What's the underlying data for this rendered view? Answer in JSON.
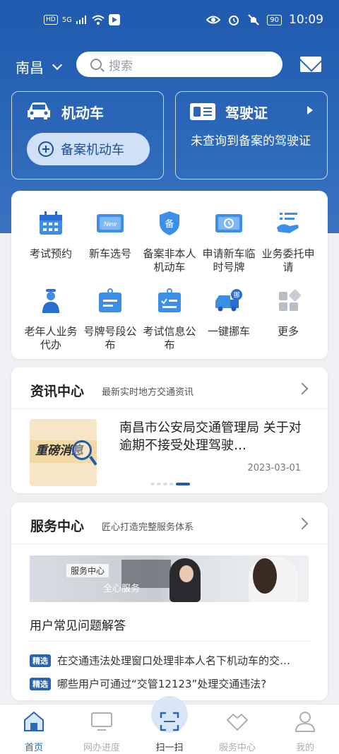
{
  "status_bar": {
    "hd": "HD",
    "signal": "5G",
    "battery": "90",
    "time": "10:09"
  },
  "header": {
    "city": "南昌",
    "search_placeholder": "搜索"
  },
  "cards": {
    "vehicle": {
      "title": "机动车",
      "button": "备案机动车"
    },
    "license": {
      "title": "驾驶证",
      "text": "未查询到备案的驾驶证"
    }
  },
  "services_grid": [
    {
      "label": "考试预约",
      "icon": "calendar-icon"
    },
    {
      "label": "新车选号",
      "icon": "new-plate-icon"
    },
    {
      "label": "备案非本人机动车",
      "icon": "record-shield-icon"
    },
    {
      "label": "申请新车临时号牌",
      "icon": "temp-plate-icon"
    },
    {
      "label": "业务委托申请",
      "icon": "delegate-icon"
    },
    {
      "label": "老年人业务代办",
      "icon": "elder-icon"
    },
    {
      "label": "号牌号段公布",
      "icon": "plate-segment-icon"
    },
    {
      "label": "考试信息公布",
      "icon": "exam-info-icon"
    },
    {
      "label": "一键挪车",
      "icon": "move-car-icon"
    },
    {
      "label": "更多",
      "icon": "more-icon"
    }
  ],
  "news": {
    "title": "资讯中心",
    "subtitle": "最新实时地方交通资讯",
    "thumb_text": "重磅消息",
    "item_title": "南昌市公安局交通管理局 关于对逾期不接受处理驾驶…",
    "item_date": "2023-03-01"
  },
  "service": {
    "title": "服务中心",
    "subtitle": "匠心打造完整服务体系",
    "banner_tag": "服务中心",
    "banner_text": "全心服务",
    "faq_title": "用户常见问题解答",
    "faq_badge": "精选",
    "faqs": [
      "在交通违法处理窗口处理非本人名下机动车的交…",
      "哪些用户可通过“交管12123”处理交通违法?"
    ]
  },
  "nav": [
    {
      "label": "首页",
      "active": true
    },
    {
      "label": "网办进度"
    },
    {
      "label": "扫一扫"
    },
    {
      "label": "服务中心"
    },
    {
      "label": "我的"
    }
  ],
  "colors": {
    "primary": "#2b66b8",
    "background": "#eef0f4"
  }
}
